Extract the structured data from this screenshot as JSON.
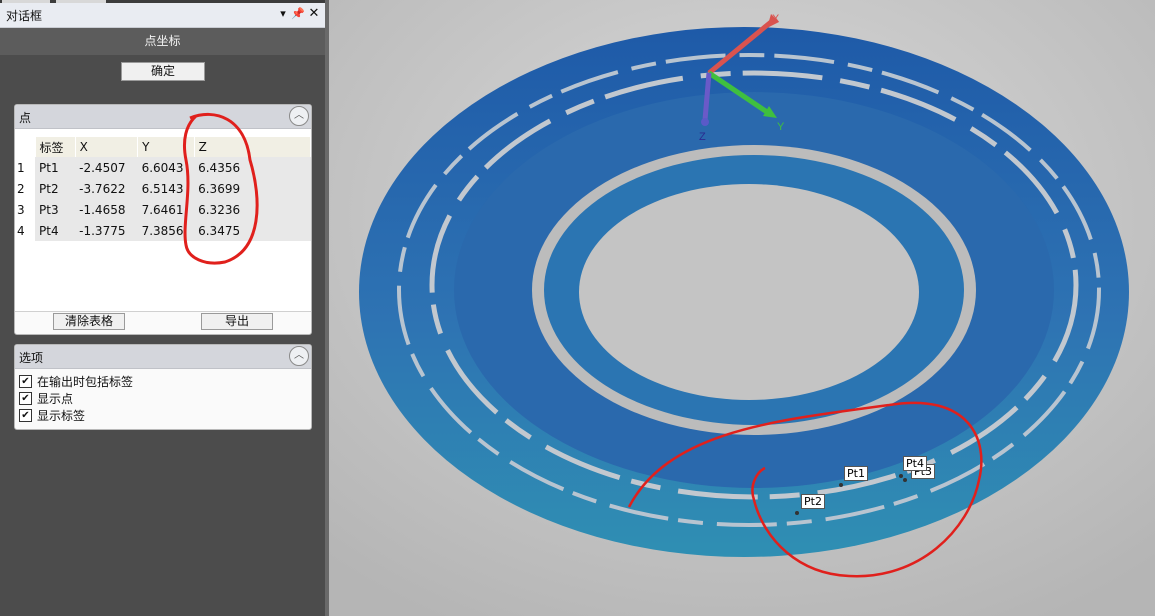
{
  "dialog": {
    "title": "对话框",
    "pin_icon": "pin-icon",
    "close_icon": "close-icon",
    "menu_icon": "dropdown-icon",
    "header": "点坐标",
    "ok_label": "确定"
  },
  "points_group": {
    "label": "点",
    "columns": [
      "标签",
      "X",
      "Y",
      "Z"
    ],
    "rows": [
      {
        "index": "1",
        "label": "Pt1",
        "x": "-2.4507",
        "y": "6.6043",
        "z": "6.4356"
      },
      {
        "index": "2",
        "label": "Pt2",
        "x": "-3.7622",
        "y": "6.5143",
        "z": "6.3699"
      },
      {
        "index": "3",
        "label": "Pt3",
        "x": "-1.4658",
        "y": "7.6461",
        "z": "6.3236"
      },
      {
        "index": "4",
        "label": "Pt4",
        "x": "-1.3775",
        "y": "7.3856",
        "z": "6.3475"
      }
    ],
    "clear_label": "清除表格",
    "export_label": "导出"
  },
  "options_group": {
    "label": "选项",
    "items": [
      {
        "label": "在输出时包括标签",
        "checked": true
      },
      {
        "label": "显示点",
        "checked": true
      },
      {
        "label": "显示标签",
        "checked": true
      }
    ]
  },
  "viewport": {
    "axes": {
      "x": "X",
      "y": "Y",
      "z": "Z"
    },
    "point_labels": [
      "Pt1",
      "Pt2",
      "Pt3",
      "Pt4"
    ],
    "colors": {
      "scan": "#2f74b5",
      "background": "#bdbdbd",
      "annotation": "#e0201c",
      "x_axis": "#d9534f",
      "y_axis": "#3fbf3f",
      "z_axis": "#5a5ac8"
    }
  }
}
